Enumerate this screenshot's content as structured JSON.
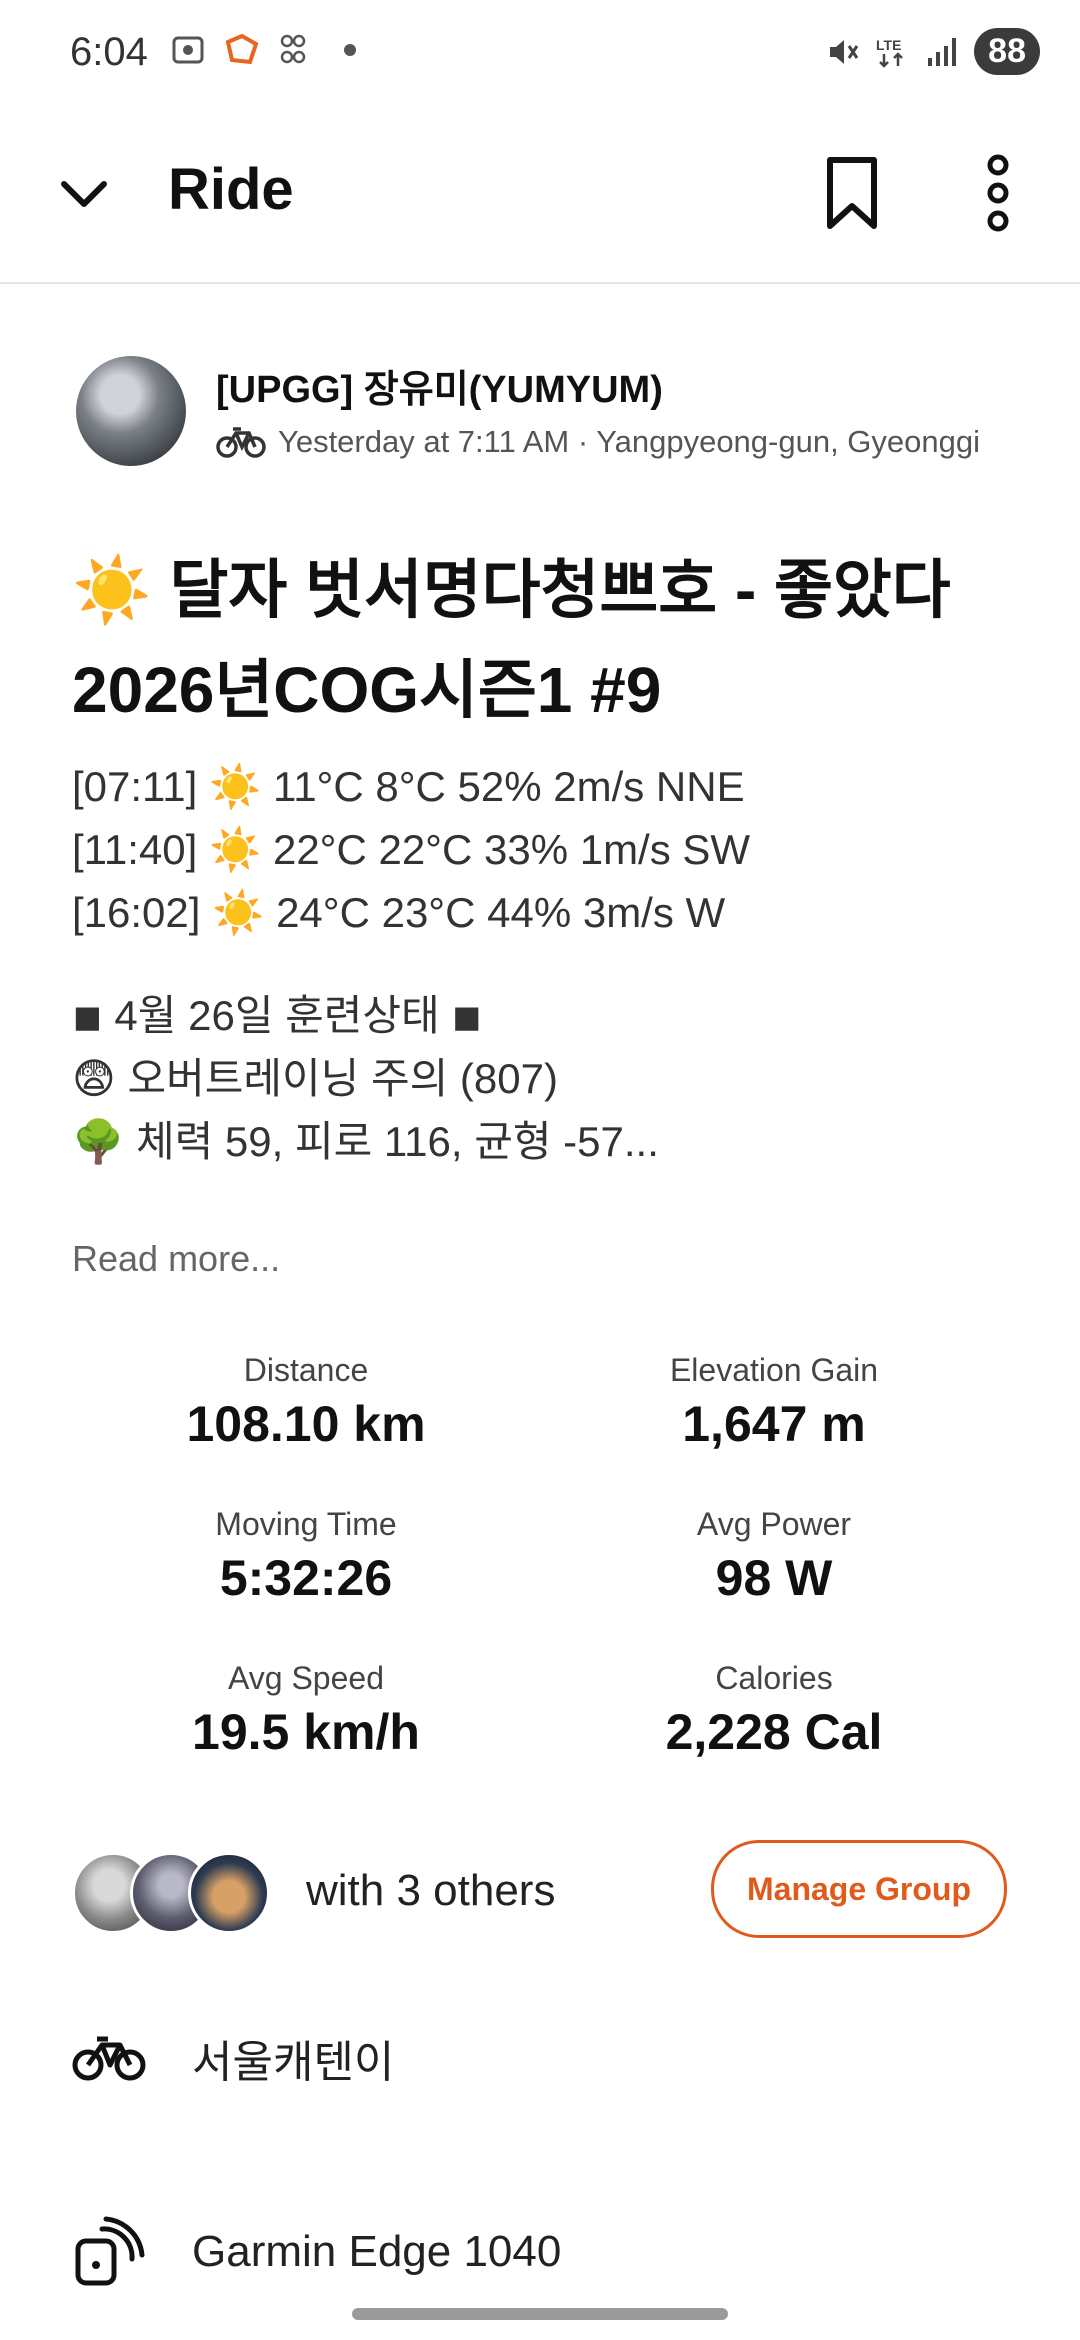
{
  "status_bar": {
    "time": "6:04",
    "battery": "88"
  },
  "app_bar": {
    "title": "Ride"
  },
  "activity": {
    "author_name": "[UPGG] 장유미(YUMYUM)",
    "meta": "Yesterday at 7:11 AM · Yangpyeong-gun, Gyeonggi",
    "title_line1": "☀️ 달자 벗서명다청쁘호 -  좋았다",
    "title_line2": "2026년COG시즌1 #9",
    "weather": [
      "[07:11] ☀️ 11°C 8°C 52% 2m/s  NNE",
      "[11:40] ☀️ 22°C 22°C 33% 1m/s  SW",
      "[16:02] ☀️ 24°C 23°C 44% 3m/s  W"
    ],
    "training": [
      "◾ 4월 26일 훈련상태 ◾",
      "😨 오버트레이닝 주의 (807)",
      "🌳 체력 59, 피로 116, 균형 -57..."
    ],
    "read_more": "Read more..."
  },
  "stats": [
    {
      "label": "Distance",
      "value": "108.10 km"
    },
    {
      "label": "Elevation Gain",
      "value": "1,647 m"
    },
    {
      "label": "Moving Time",
      "value": "5:32:26"
    },
    {
      "label": "Avg Power",
      "value": "98 W"
    },
    {
      "label": "Avg Speed",
      "value": "19.5 km/h"
    },
    {
      "label": "Calories",
      "value": "2,228 Cal"
    }
  ],
  "group": {
    "with_text": "with 3 others",
    "button_label": "Manage Group"
  },
  "gear": {
    "bike_name": "서울캐텐이"
  },
  "device": {
    "name": "Garmin Edge 1040"
  },
  "colors": {
    "accent": "#e05a1b",
    "text": "#111111",
    "muted": "#555555"
  }
}
